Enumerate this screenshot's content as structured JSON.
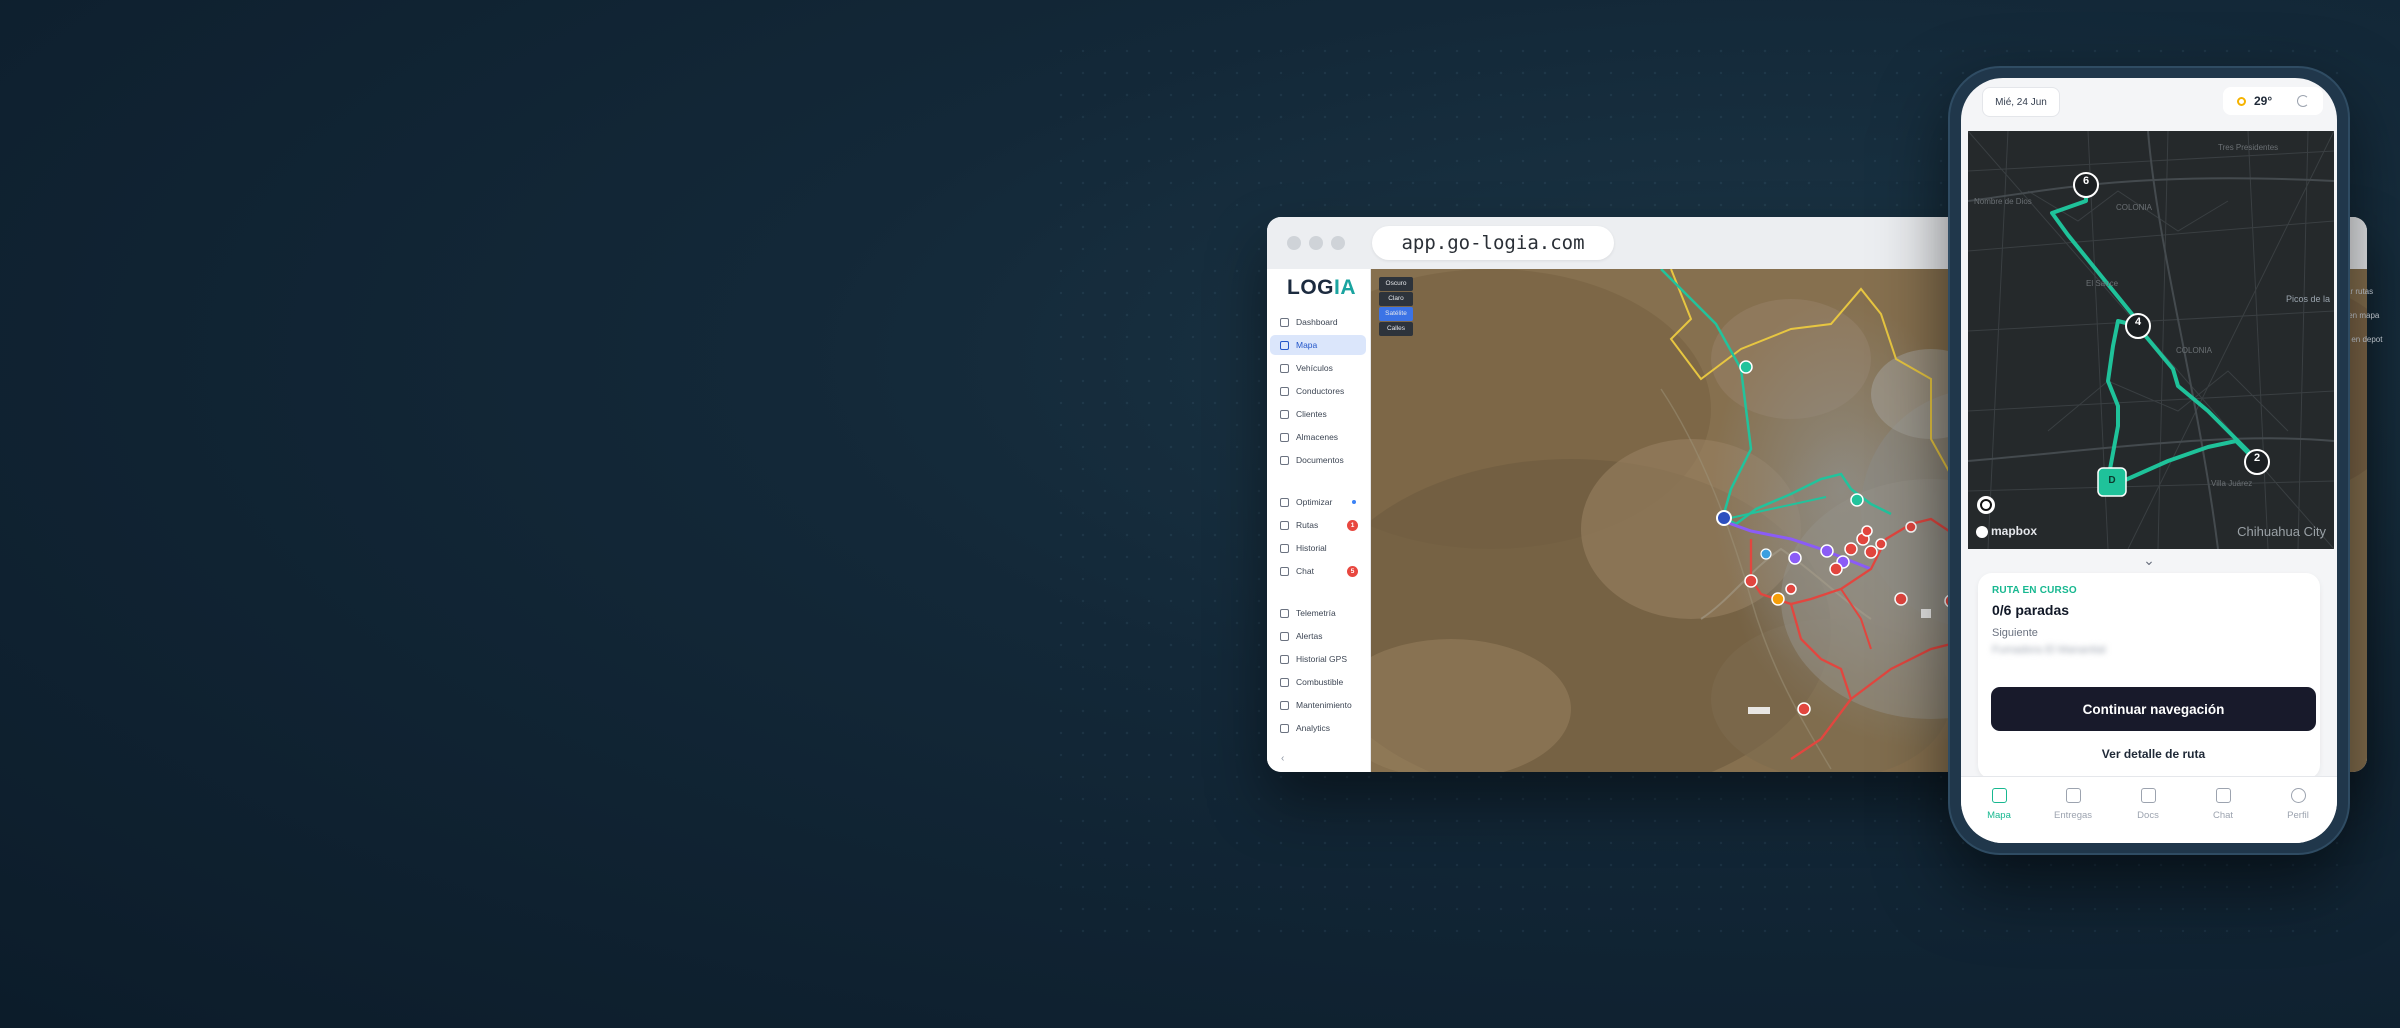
{
  "browser": {
    "url": "app.go-logia.com"
  },
  "sidebar": {
    "logo_main": "LOG",
    "logo_accent": "IA",
    "items": [
      {
        "label": "Dashboard",
        "icon": "dashboard-icon"
      },
      {
        "label": "Mapa",
        "icon": "map-icon",
        "active": true
      },
      {
        "label": "Vehículos",
        "icon": "truck-icon"
      },
      {
        "label": "Conductores",
        "icon": "users-icon"
      },
      {
        "label": "Clientes",
        "icon": "client-icon"
      },
      {
        "label": "Almacenes",
        "icon": "warehouse-icon"
      },
      {
        "label": "Documentos",
        "icon": "document-icon"
      },
      {
        "label": "Optimizar",
        "icon": "optimize-icon"
      },
      {
        "label": "Rutas",
        "icon": "route-icon",
        "badge": "1"
      },
      {
        "label": "Historial",
        "icon": "history-icon"
      },
      {
        "label": "Chat",
        "icon": "chat-icon",
        "badge": "5"
      },
      {
        "label": "Telemetría",
        "icon": "telemetry-icon"
      },
      {
        "label": "Alertas",
        "icon": "bell-icon"
      },
      {
        "label": "Historial GPS",
        "icon": "clock-icon"
      },
      {
        "label": "Combustible",
        "icon": "fuel-icon"
      },
      {
        "label": "Mantenimiento",
        "icon": "wrench-icon"
      },
      {
        "label": "Analytics",
        "icon": "chart-icon"
      }
    ],
    "collapse_glyph": "‹"
  },
  "map_layers": {
    "options": [
      "Oscuro",
      "Claro",
      "Satélite",
      "Calles"
    ],
    "selected": "Satélite"
  },
  "right_menu": {
    "items": [
      "ltar rutas",
      "s en mapa",
      "ar en depot"
    ],
    "partial_text": "Picos de la"
  },
  "phone": {
    "date": "Mié, 24 Jun",
    "temperature": "29°",
    "map": {
      "markers": [
        "6",
        "4",
        "2",
        "D"
      ],
      "city_label": "Chihuahua City",
      "attribution": "mapbox",
      "area_labels": [
        "COLONIA",
        "COLONIA",
        "Nombre de Dios",
        "Villa Juárez",
        "El Sauce",
        "Tres Presidentes"
      ]
    },
    "route": {
      "status_label": "RUTA EN CURSO",
      "stops": "0/6 paradas",
      "next_label": "Siguiente",
      "next_value": "Fumadora El Manantial",
      "primary_button": "Continuar navegación",
      "secondary_button": "Ver detalle de ruta"
    },
    "tabs": [
      {
        "label": "Mapa",
        "icon": "map-icon",
        "active": true
      },
      {
        "label": "Entregas",
        "icon": "package-icon"
      },
      {
        "label": "Docs",
        "icon": "document-icon"
      },
      {
        "label": "Chat",
        "icon": "chat-icon"
      },
      {
        "label": "Perfil",
        "icon": "user-icon"
      }
    ]
  },
  "colors": {
    "accent": "#17b890",
    "route_green": "#22c39c",
    "route_red": "#e2463f",
    "route_purple": "#8b5cf6",
    "zone_yellow": "#e7c641",
    "sidebar_active": "#2356c9"
  }
}
